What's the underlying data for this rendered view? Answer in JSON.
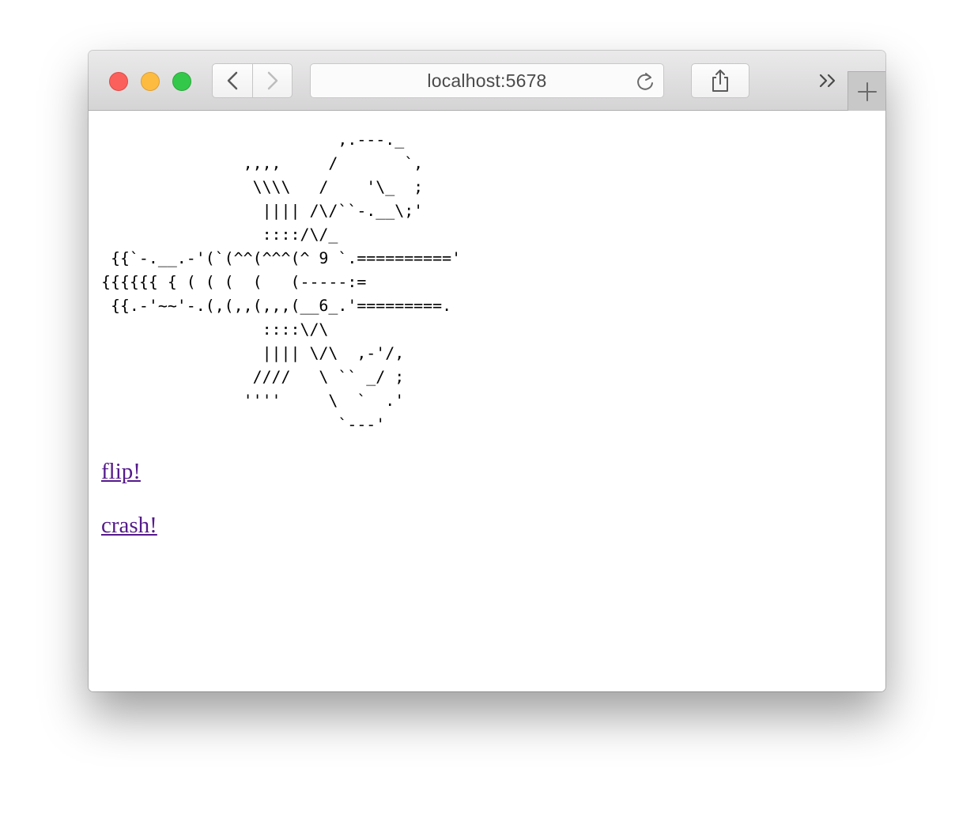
{
  "browser": {
    "url": "localhost:5678",
    "back_icon": "chevron-left-icon",
    "forward_icon": "chevron-right-icon",
    "reload_icon": "reload-icon",
    "share_icon": "share-icon",
    "overflow_icon": "double-chevron-right-icon",
    "new_tab_icon": "plus-icon"
  },
  "page": {
    "ascii_art": "                         ,.---._\n               ,,,,     /       `,\n                \\\\\\\\   /    '\\_  ;\n                 |||| /\\/``-.__\\;'\n                 ::::/\\/_\n {{`-.__.-'(`(^^(^^^(^ 9 `.=========='\n{{{{{{ { ( ( (  (   (-----:=\n {{.-'~~'-.(,(,,(,,,(__6_.'=========.\n                 ::::\\/\\\n                 |||| \\/\\  ,-'/,\n                ////   \\ `` _/ ;\n               ''''     \\  `  .'\n                         `---'",
    "links": [
      {
        "label": "flip!"
      },
      {
        "label": "crash!"
      }
    ]
  }
}
